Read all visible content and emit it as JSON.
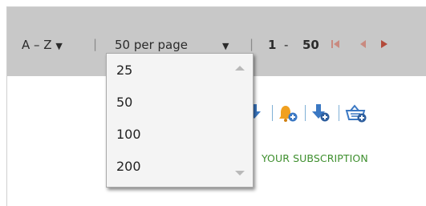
{
  "toolbar": {
    "sort_label": "A – Z",
    "sort_caret": "▼",
    "separator": "|",
    "per_page_label": "50 per page",
    "per_page_caret": "▼",
    "range_start": "1",
    "range_dash": "-",
    "range_end": "50"
  },
  "dropdown": {
    "options": [
      "25",
      "50",
      "100",
      "200"
    ]
  },
  "content": {
    "subscription_text": "YOUR SUBSCRIPTION"
  },
  "colors": {
    "toolbar_bg": "#c8c8c8",
    "nav_arrow": "#b34a3a",
    "link_green": "#3e8f2e",
    "bell_orange": "#f0a020",
    "blue_icon": "#3b78c3"
  }
}
